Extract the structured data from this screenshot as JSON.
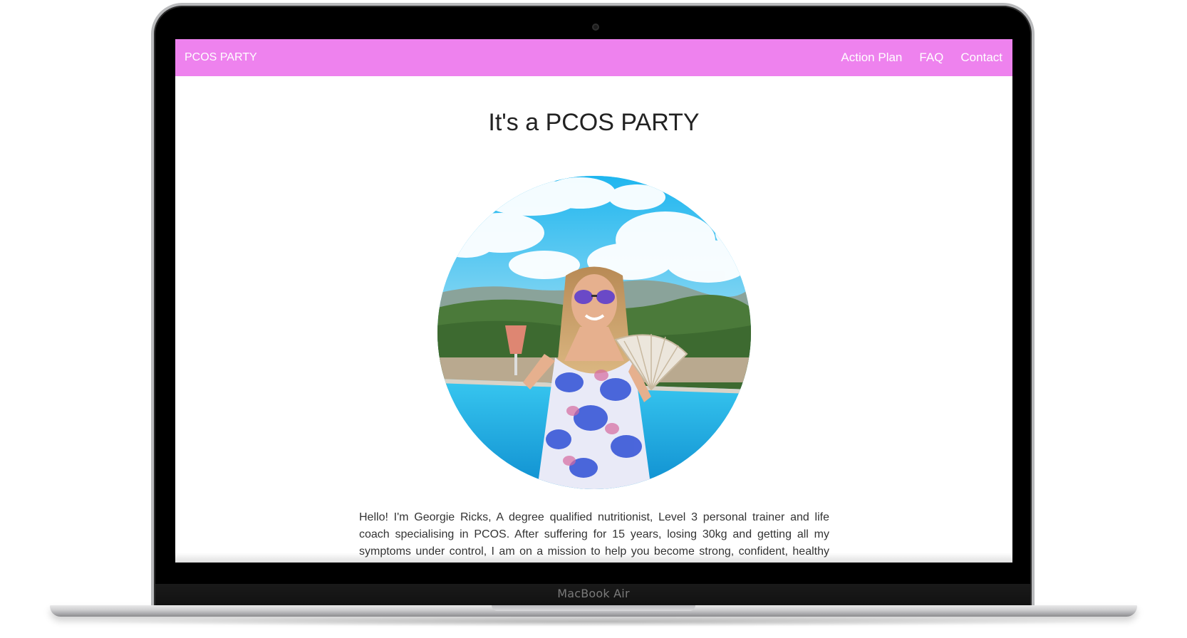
{
  "device": {
    "label": "MacBook Air"
  },
  "navbar": {
    "brand": "PCOS PARTY",
    "links": [
      "Action Plan",
      "FAQ",
      "Contact"
    ],
    "color": "#ee82ee"
  },
  "hero": {
    "title": "It's a PCOS PARTY"
  },
  "intro": {
    "text": "Hello! I'm Georgie Ricks, A degree qualified nutritionist, Level 3 personal trainer and life coach specialising in PCOS. After suffering for 15 years, losing 30kg and getting all my symptoms under control, I am on a mission to help you become strong, confident, healthy and happy - as"
  }
}
